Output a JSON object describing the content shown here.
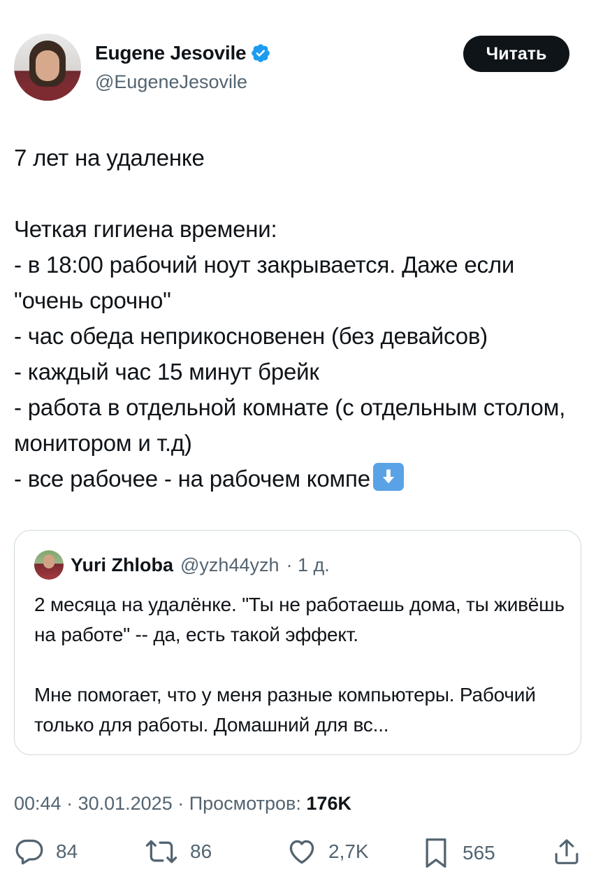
{
  "author": {
    "name": "Eugene Jesovile",
    "handle": "@EugeneJesovile",
    "verified": true
  },
  "follow_button": {
    "label": "Читать"
  },
  "tweet": {
    "text": "7 лет на удаленке\n\nЧеткая гигиена времени:\n- в 18:00 рабочий ноут закрывается. Даже если \"очень срочно\"\n- час обеда неприкосновенен (без девайсов)\n- каждый час 15 минут брейк\n- работа в отдельной комнате (с отдельным столом, монитором и т.д)\n- все рабочее - на рабочем компе",
    "emoji": "down-arrow-emoji"
  },
  "quote": {
    "name": "Yuri Zhloba",
    "handle": "@yzh44yzh",
    "age": "· 1 д.",
    "text": "2 месяца на удалёнке. \"Ты не работаешь дома, ты живёшь на работе\" -- да, есть такой эффект.\n\nМне помогает, что у меня разные компьютеры. Рабочий только для работы. Домашний для вс..."
  },
  "meta": {
    "time": "00:44",
    "separator": " · ",
    "date": "30.01.2025",
    "views_label": "Просмотров:",
    "views_count": "176K"
  },
  "actions": {
    "replies": "84",
    "reposts": "86",
    "likes": "2,7K",
    "bookmarks": "565"
  },
  "colors": {
    "text": "#0f1419",
    "secondary": "#536471",
    "border": "#cfd9de",
    "verified": "#1d9bf0",
    "button_bg": "#0f1419"
  }
}
